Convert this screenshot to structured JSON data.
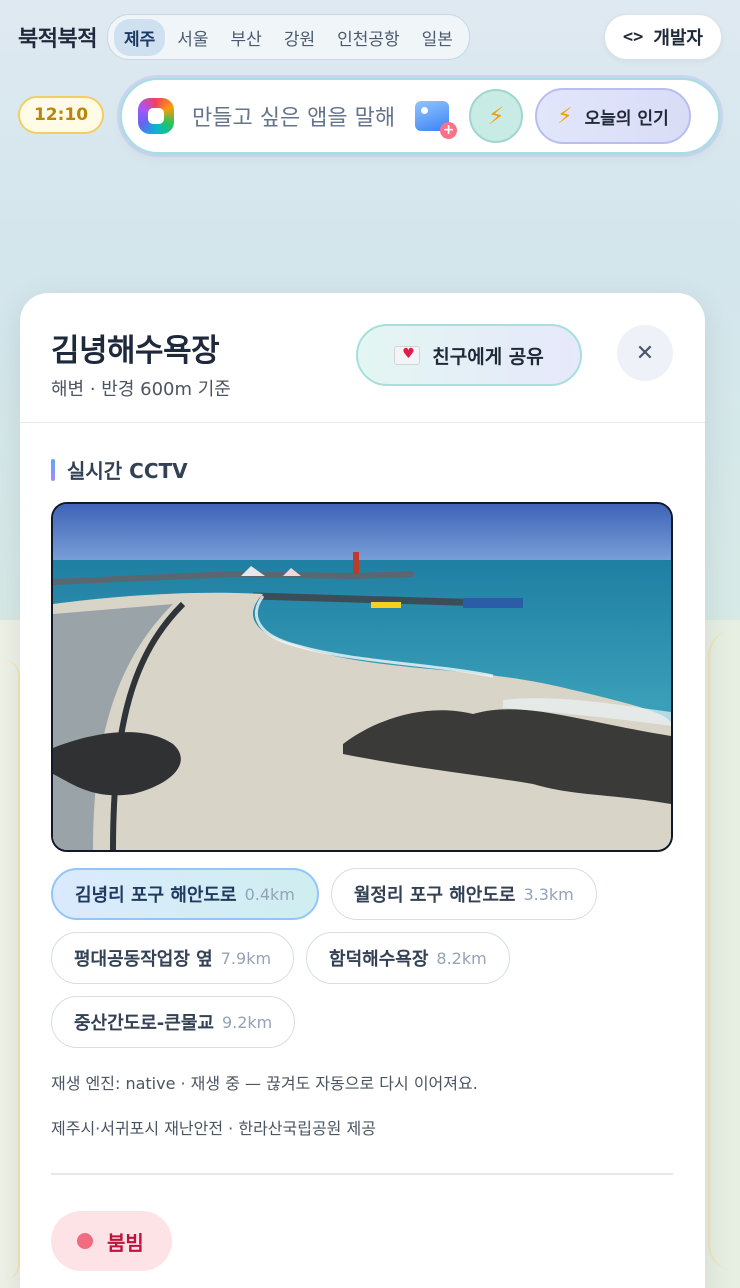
{
  "header": {
    "brand": "북적북적",
    "regions": [
      "제주",
      "서울",
      "부산",
      "강원",
      "인천공항",
      "일본"
    ],
    "active_region": "제주",
    "dev_button_icon": "<>",
    "dev_button_label": "개발자"
  },
  "status": {
    "time": "12:10"
  },
  "prompt": {
    "placeholder": "만들고 싶은 앱을 말해",
    "quick_icon": "⚡",
    "popular_icon": "⚡",
    "popular_label": "오늘의 인기"
  },
  "card": {
    "title": "김녕해수욕장",
    "subtitle": "해변 · 반경 600m 기준",
    "share_label": "친구에게 공유",
    "close_glyph": "✕",
    "section_title": "실시간 CCTV",
    "cameras": [
      {
        "name": "김녕리 포구 해안도로",
        "distance": "0.4km",
        "active": true
      },
      {
        "name": "월정리 포구 해안도로",
        "distance": "3.3km",
        "active": false
      },
      {
        "name": "평대공동작업장 옆",
        "distance": "7.9km",
        "active": false
      },
      {
        "name": "함덕해수욕장",
        "distance": "8.2km",
        "active": false
      },
      {
        "name": "중산간도로-큰물교",
        "distance": "9.2km",
        "active": false
      }
    ],
    "engine_note": "재생 엔진: native · 재생 중 — 끊겨도 자동으로 다시 이어져요.",
    "credit_note": "제주시·서귀포시 재난안전 · 한라산국립공원 제공",
    "crowd_label": "붐빔"
  },
  "colors": {
    "accent_blue": "#93c5fd",
    "accent_teal": "#a5e0dc",
    "crowd_red": "#be123c",
    "time_yellow": "#f2cf62"
  },
  "icons": [
    "code-icon",
    "app-logo-icon",
    "image-add-icon",
    "bolt-icon",
    "envelope-heart-icon",
    "close-icon"
  ]
}
